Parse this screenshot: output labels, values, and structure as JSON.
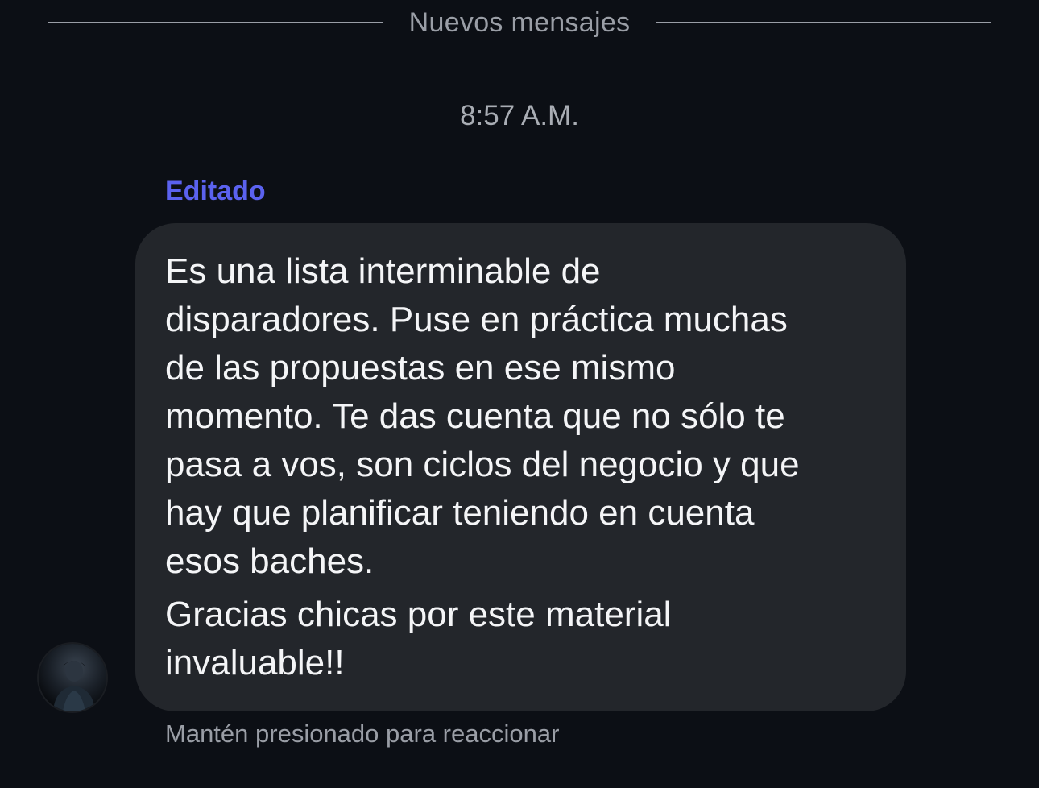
{
  "divider": {
    "label": "Nuevos mensajes"
  },
  "timestamp": "8:57 A.M.",
  "message": {
    "edited_label": "Editado",
    "paragraphs": [
      "Es una lista interminable de\ndisparadores. Puse en práctica muchas\nde las propuestas en ese mismo\nmomento. Te das cuenta que no sólo te\npasa a vos, son ciclos del negocio y que\nhay que planificar teniendo en cuenta\nesos baches.",
      "Gracias chicas por este material\ninvaluable!!"
    ],
    "avatar": "user-avatar-photo"
  },
  "hint": "Mantén presionado para reaccionar",
  "colors": {
    "background": "#0c0f15",
    "bubble": "#23262b",
    "accent": "#5b62ef",
    "muted_text": "#9a9ea6"
  }
}
